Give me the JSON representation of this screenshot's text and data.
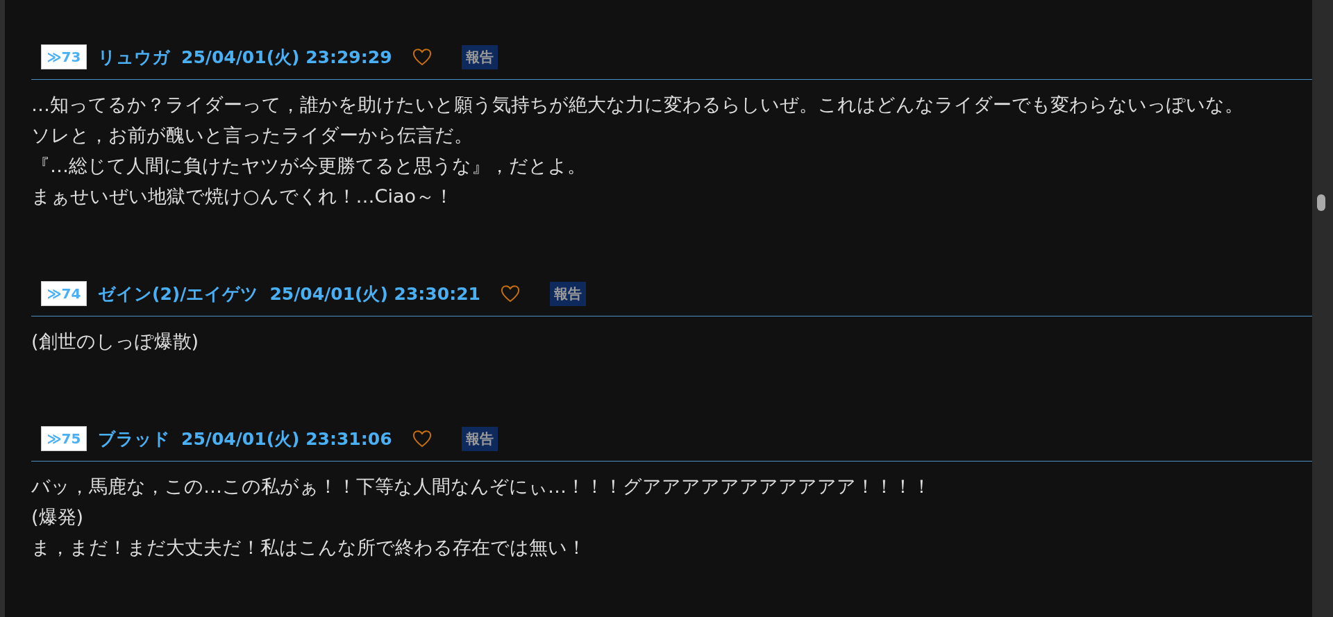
{
  "posts": [
    {
      "number": "≫73",
      "name": "リュウガ",
      "date": "25/04/01(火) 23:29:29",
      "liked": false,
      "report": "報告",
      "lines": [
        "…知ってるか？ライダーって，誰かを助けたいと願う気持ちが絶大な力に変わるらしいぜ。これはどんなライダーでも変わらないっぽいな。",
        "ソレと，お前が醜いと言ったライダーから伝言だ。",
        "『…総じて人間に負けたヤツが今更勝てると思うな』，だとよ。",
        "まぁせいぜい地獄で焼け○んでくれ！…Ciao～！"
      ]
    },
    {
      "number": "≫74",
      "name": "ゼイン(2)/エイゲツ",
      "date": "25/04/01(火) 23:30:21",
      "liked": false,
      "report": "報告",
      "lines": [
        "(創世のしっぽ爆散)"
      ]
    },
    {
      "number": "≫75",
      "name": "ブラッド",
      "date": "25/04/01(火) 23:31:06",
      "liked": false,
      "report": "報告",
      "lines": [
        "バッ，馬鹿な，この…この私がぁ！！下等な人間なんぞにぃ…！！！グアアアアアアアアアアア！！！！",
        "(爆発)",
        "ま，まだ！まだ大丈夫だ！私はこんな所で終わる存在では無い！"
      ]
    }
  ]
}
